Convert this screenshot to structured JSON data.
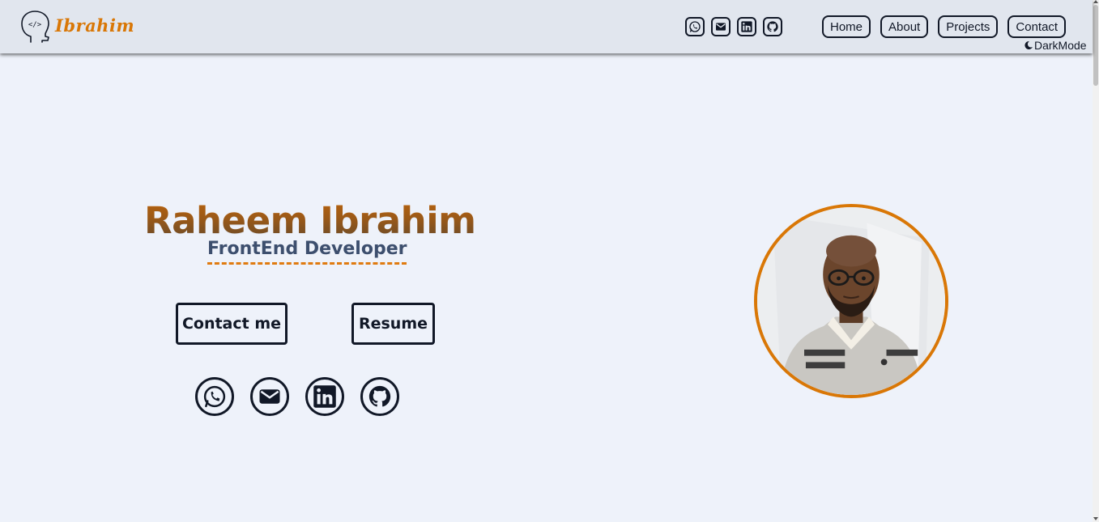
{
  "header": {
    "logo_text": "Ibrahim",
    "social_icons": [
      "whatsapp-icon",
      "mail-icon",
      "linkedin-icon",
      "github-icon"
    ],
    "nav": [
      "Home",
      "About",
      "Projects",
      "Contact"
    ],
    "dark_mode_label": "DarkMode"
  },
  "hero": {
    "name": "Raheem Ibrahim",
    "role": "FrontEnd Developer",
    "contact_button": "Contact me",
    "resume_button": "Resume",
    "social_icons": [
      "whatsapp-icon",
      "mail-icon",
      "linkedin-icon",
      "github-icon"
    ]
  },
  "colors": {
    "accent": "#d97706",
    "dark": "#111827",
    "background": "#eef2fa",
    "header_bg": "#e1e6ee"
  }
}
